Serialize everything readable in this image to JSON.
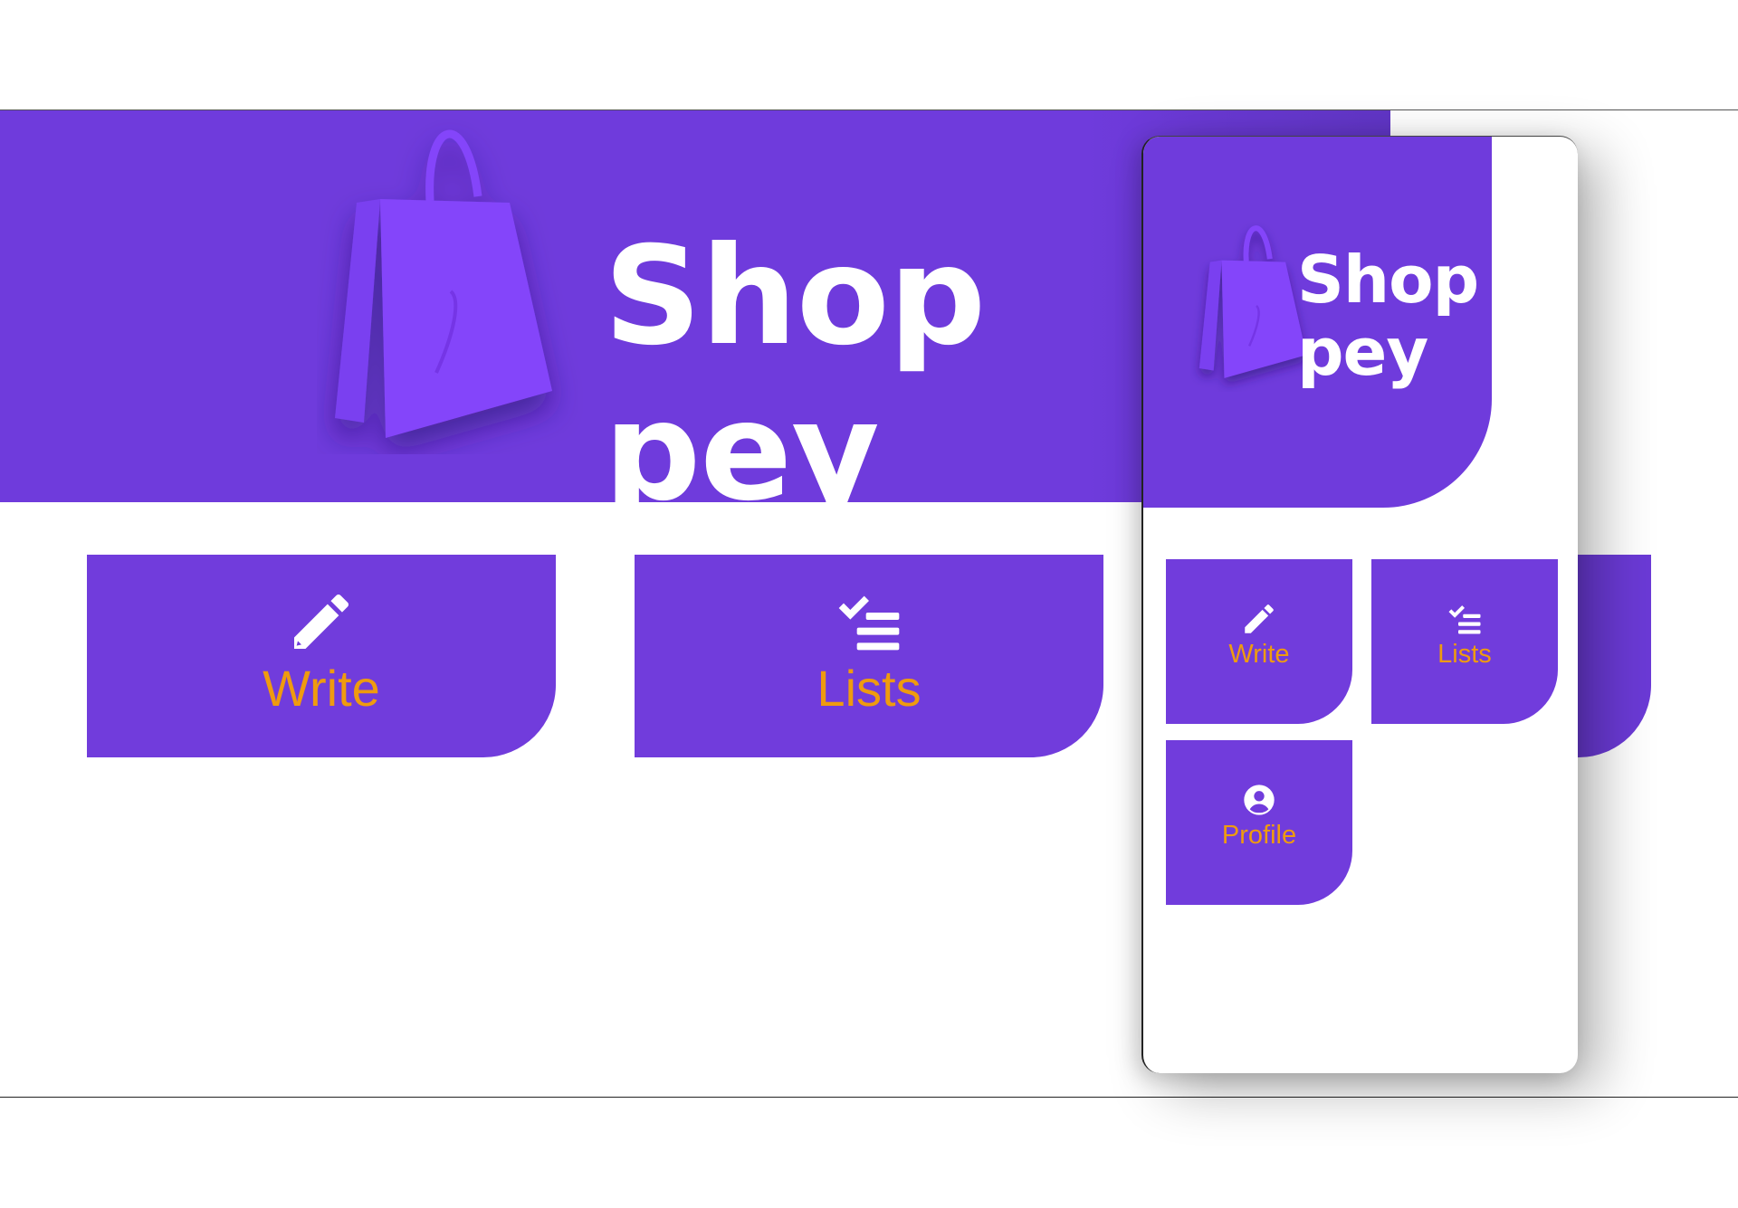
{
  "brand": {
    "name": "Shop\npey",
    "color_primary": "#713cdc",
    "color_label": "#ef9b0f",
    "bag_color": "#8445fa"
  },
  "desktop": {
    "menu": [
      {
        "label": "Write",
        "icon": "pencil-icon"
      },
      {
        "label": "Lists",
        "icon": "checklist-icon"
      }
    ]
  },
  "mobile": {
    "menu": [
      {
        "label": "Write",
        "icon": "pencil-icon"
      },
      {
        "label": "Lists",
        "icon": "checklist-icon"
      },
      {
        "label": "Profile",
        "icon": "account-circle-icon"
      }
    ]
  }
}
